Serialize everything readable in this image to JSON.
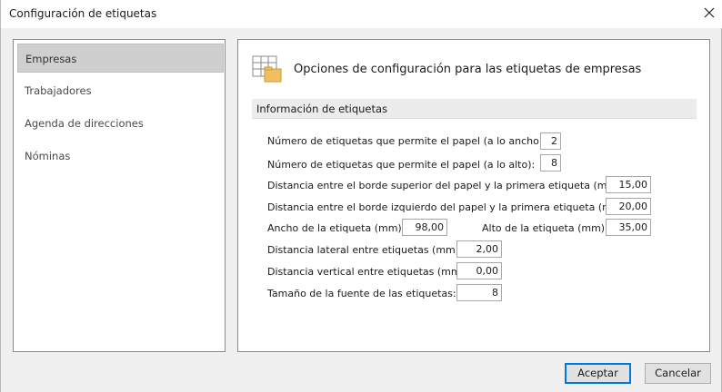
{
  "window": {
    "title": "Configuración de etiquetas"
  },
  "sidebar": {
    "items": [
      {
        "label": "Empresas",
        "selected": true
      },
      {
        "label": "Trabajadores",
        "selected": false
      },
      {
        "label": "Agenda de direcciones",
        "selected": false
      },
      {
        "label": "Nóminas",
        "selected": false
      }
    ]
  },
  "panel": {
    "title": "Opciones de configuración para las etiquetas de empresas",
    "section": "Información de etiquetas",
    "fields": {
      "ancho_count": {
        "label": "Número de etiquetas que permite el papel (a lo ancho):",
        "value": "2"
      },
      "alto_count": {
        "label": "Número de etiquetas que permite el papel (a lo alto):",
        "value": "8"
      },
      "dist_superior": {
        "label": "Distancia entre el borde superior del papel y la primera etiqueta (mm):",
        "value": "15,00"
      },
      "dist_izquierdo": {
        "label": "Distancia entre el borde izquierdo del papel y la primera etiqueta (mm):",
        "value": "20,00"
      },
      "ancho_etiqueta": {
        "label": "Ancho de la etiqueta (mm):",
        "value": "98,00"
      },
      "alto_etiqueta": {
        "label": "Alto de la etiqueta (mm):",
        "value": "35,00"
      },
      "dist_lateral": {
        "label": "Distancia lateral entre etiquetas (mm):",
        "value": "2,00"
      },
      "dist_vertical": {
        "label": "Distancia vertical entre etiquetas (mm):",
        "value": "0,00"
      },
      "tamano_fuente": {
        "label": "Tamaño de la fuente de las etiquetas:",
        "value": "8"
      }
    }
  },
  "footer": {
    "accept_label": "Aceptar",
    "cancel_label": "Cancelar"
  },
  "icons": {
    "close": "close-icon",
    "panel": "labels-config-icon"
  },
  "colors": {
    "accent": "#0078d7",
    "selected_bg": "#cfcfcf",
    "folder": "#f0c060"
  }
}
